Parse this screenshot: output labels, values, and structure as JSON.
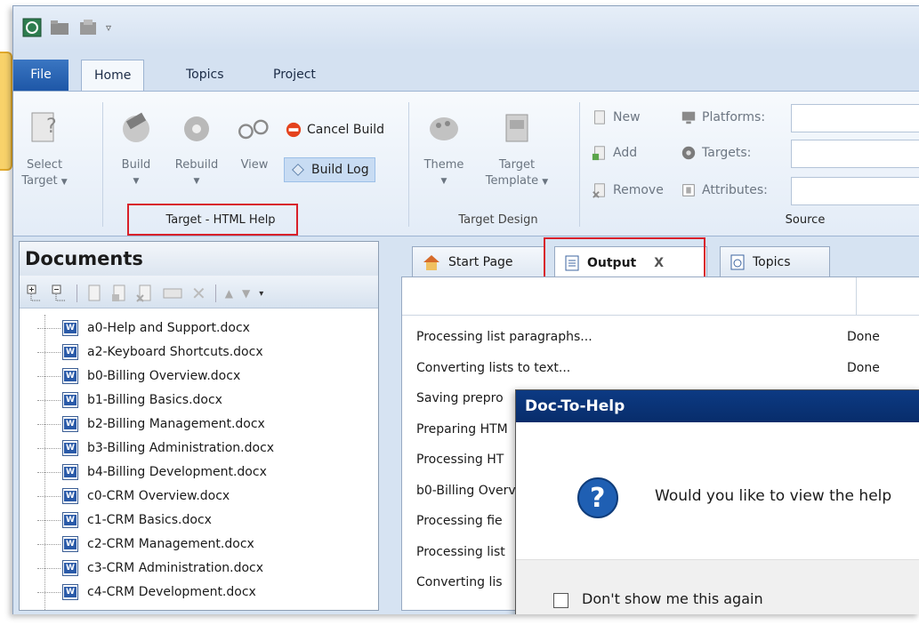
{
  "ribbon_tabs": [
    "File",
    "Home",
    "Topics",
    "Project"
  ],
  "ribbon": {
    "select_target": [
      "Select",
      "Target"
    ],
    "build": "Build",
    "rebuild": "Rebuild",
    "view": "View",
    "cancel_build": "Cancel Build",
    "build_log": "Build Log",
    "group_target": "Target - HTML Help",
    "theme": "Theme",
    "target_template": [
      "Target",
      "Template"
    ],
    "group_design": "Target Design",
    "new": "New",
    "add": "Add",
    "remove": "Remove",
    "platforms": "Platforms:",
    "targets": "Targets:",
    "attributes": "Attributes:",
    "group_source": "Source"
  },
  "documents": {
    "title": "Documents",
    "items": [
      "a0-Help and Support.docx",
      "a2-Keyboard Shortcuts.docx",
      "b0-Billing Overview.docx",
      "b1-Billing Basics.docx",
      "b2-Billing Management.docx",
      "b3-Billing Administration.docx",
      "b4-Billing Development.docx",
      "c0-CRM Overview.docx",
      "c1-CRM Basics.docx",
      "c2-CRM Management.docx",
      "c3-CRM Administration.docx",
      "c4-CRM Development.docx"
    ]
  },
  "doc_tabs": {
    "start_page": "Start Page",
    "output": "Output",
    "output_close": "X",
    "topics": "Topics"
  },
  "output_rows": [
    {
      "message": "Processing list paragraphs...",
      "status": "Done"
    },
    {
      "message": "Converting lists to text...",
      "status": "Done"
    },
    {
      "message": "Saving prepro",
      "status": ""
    },
    {
      "message": "Preparing HTM",
      "status": ""
    },
    {
      "message": "Processing HT",
      "status": ""
    },
    {
      "message": "b0-Billing Overv",
      "status": ""
    },
    {
      "message": "Processing fie",
      "status": ""
    },
    {
      "message": "Processing list",
      "status": ""
    },
    {
      "message": "Converting lis",
      "status": ""
    }
  ],
  "dialog": {
    "title": "Doc-To-Help",
    "question": "Would you like to view the help",
    "checkbox_label": "Don't show me this again"
  },
  "colors": {
    "highlight": "#d8202a",
    "dialog_title": "#0c3a83",
    "file_tab": "#1e57a7"
  }
}
